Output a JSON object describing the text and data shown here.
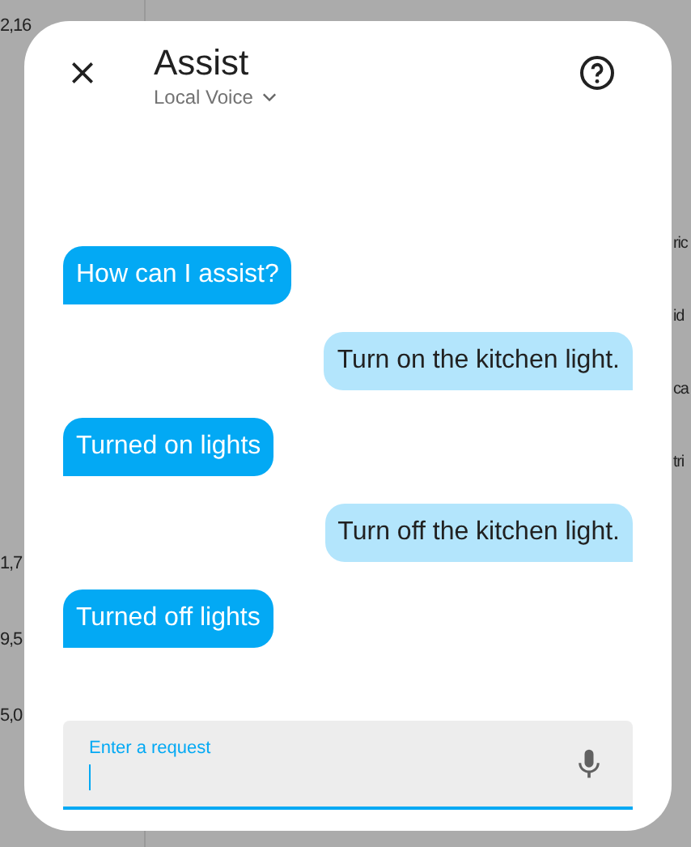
{
  "background": {
    "left_column": [
      "2,16",
      "1,7",
      "9,5",
      "5,0"
    ],
    "right_column": [
      "ric",
      "id",
      "ca",
      "tri"
    ]
  },
  "dialog": {
    "title": "Assist",
    "pipeline": "Local Voice",
    "messages": [
      {
        "kind": "assistant",
        "text": "How can I assist?"
      },
      {
        "kind": "user",
        "text": "Turn on the kitchen light."
      },
      {
        "kind": "assistant",
        "text": "Turned on lights"
      },
      {
        "kind": "user",
        "text": "Turn off the kitchen light."
      },
      {
        "kind": "assistant",
        "text": "Turned off lights"
      }
    ],
    "input": {
      "placeholder": "Enter a request"
    }
  }
}
